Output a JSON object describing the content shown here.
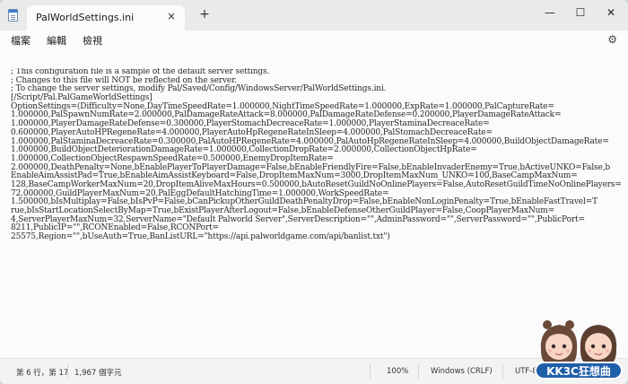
{
  "title_bar": {
    "tab_title": "PalWorldSettings.ini",
    "close_tab_glyph": "×",
    "new_tab_glyph": "+",
    "minimize_glyph": "—",
    "maximize_glyph": "☐",
    "close_glyph": "✕"
  },
  "menu": {
    "items": [
      "檔案",
      "編輯",
      "檢視"
    ],
    "settings_icon": "gear-icon"
  },
  "editor": {
    "lines": [
      "; This configuration file is a sample of the default server settings.",
      "; Changes to this file will NOT be reflected on the server.",
      "; To change the server settings, modify Pal/Saved/Config/WindowsServer/PalWorldSettings.ini.",
      "[/Script/Pal.PalGameWorldSettings]",
      "OptionSettings=(Difficulty=None,DayTimeSpeedRate=1.000000,NightTimeSpeedRate=1.000000,ExpRate=1.000000,PalCaptureRate=",
      "1.000000,PalSpawnNumRate=2.000000,PalDamageRateAttack=8.000000,PalDamageRateDefense=0.200000,PlayerDamageRateAttack=",
      "1.000000,PlayerDamageRateDefense=0.300000,PlayerStomachDecreaceRate=1.000000,PlayerStaminaDecreaceRate=",
      "0.600000,PlayerAutoHPRegeneRate=4.000000,PlayerAutoHpRegeneRateInSleep=4.000000,PalStomachDecreaceRate=",
      "1.000000,PalStaminaDecreaceRate=0.300000,PalAutoHPRegeneRate=4.000000,PalAutoHpRegeneRateInSleep=4.000000,BuildObjectDamageRate=",
      "1.000000,BuildObjectDeteriorationDamageRate=1.000000,CollectionDropRate=2.000000,CollectionObjectHpRate=",
      "1.000000,CollectionObjectRespawnSpeedRate=0.500000,EnemyDropItemRate=",
      "2.000000,DeathPenalty=None,bEnablePlayerToPlayerDamage=False,bEnableFriendlyFire=False,bEnableInvaderEnemy=True,bActiveUNKO=False,b",
      "EnableAimAssistPad=True,bEnableAimAssistKeyboard=False,DropItemMaxNum=3000,DropItemMaxNum_UNKO=100,BaseCampMaxNum=",
      "128,BaseCampWorkerMaxNum=20,DropItemAliveMaxHours=0.500000,bAutoResetGuildNoOnlinePlayers=False,AutoResetGuildTimeNoOnlinePlayers=",
      "72.000000,GuildPlayerMaxNum=20,PalEggDefaultHatchingTime=1.000000,WorkSpeedRate=",
      "1.500000,bIsMultiplay=False,bIsPvP=False,bCanPickupOtherGuildDeathPenaltyDrop=False,bEnableNonLoginPenalty=True,bEnableFastTravel=T",
      "rue,bIsStartLocationSelectByMap=True,bExistPlayerAfterLogout=False,bEnableDefenseOtherGuildPlayer=False,CoopPlayerMaxNum=",
      "4,ServerPlayerMaxNum=32,ServerName=\"Default Palworld Server\",ServerDescription=\"\",AdminPassword=\"\",ServerPassword=\"\",PublicPort=",
      "8211,PublicIP=\"\",RCONEnabled=False,RCONPort=",
      "25575,Region=\"\",bUseAuth=True,BanListURL=\"https://api.palworldgame.com/api/banlist.txt\")"
    ]
  },
  "status_bar": {
    "position": "第 6 行，第 17",
    "char_count": "1,967 個字元",
    "zoom": "100%",
    "line_ending": "Windows (CRLF)",
    "encoding": "UTF-8"
  },
  "watermark": {
    "text": "KK3C狂想曲"
  }
}
